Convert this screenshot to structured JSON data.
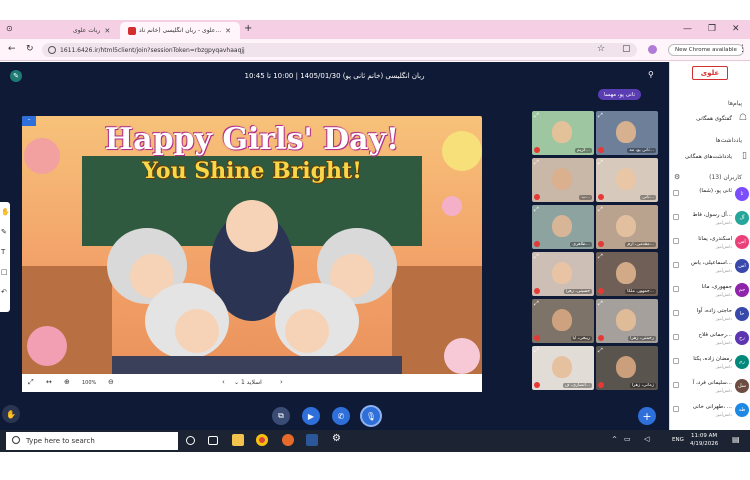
{
  "browser": {
    "tabs": [
      {
        "label": "ربات علوی"
      },
      {
        "label": "علوی - ربان انگلیسی (خانم ناد..."
      }
    ],
    "new_tab": "+",
    "url": "1611.6426.ir/html5client/join?sessionToken=rbzgpyqavhaaqjj",
    "chrome_available": "New Chrome available"
  },
  "app": {
    "title": "ربان انگلیسی (خانم ثانی پو) 1405/01/30 | 10:00 تا 10:45",
    "presenter_badge": "نانی پو، مهسا",
    "slide": {
      "line1": "Happy Girls' Day!",
      "line2": "You Shine Bright!",
      "slide_label": "اسلاید 1",
      "zoom": "100%"
    },
    "participants": [
      {
        "name": "ثانی پو، مه..."
      },
      {
        "name": "کریم..."
      },
      {
        "name": "ثانی..."
      },
      {
        "name": "ب..."
      },
      {
        "name": "مقدمی، ارم..."
      },
      {
        "name": "طاهری..."
      },
      {
        "name": "جمهور، ملکا..."
      },
      {
        "name": "حسینی، زهرا"
      },
      {
        "name": "رحمتی، زهرا"
      },
      {
        "name": "ربیعی، آیا"
      },
      {
        "name": "زمانی، زهرا"
      },
      {
        "name": "انصاری، ف..."
      },
      {
        "name": "صالحی، ملیکا"
      },
      {
        "name": "عادی، کیمیا"
      },
      {
        "name": "حسینی، فاطمه"
      },
      {
        "name": "کریمی، یاسمن"
      }
    ]
  },
  "sidebar": {
    "logo": "علوی",
    "messages_header": "پیام‌ها",
    "chat_item": "گفتگوی همگانی",
    "notes_header": "یادداشت‌ها",
    "notes_item": "یادداشت‌های همگانی",
    "users_header": "کاربران (13)",
    "users": [
      {
        "name": "ثانی پو، (شما)",
        "sub": "",
        "initials": "ثا",
        "color": "#7c4dff"
      },
      {
        "name": "آل رسول، فاط...",
        "sub": "دانش‌آموز",
        "initials": "آل",
        "color": "#26a69a"
      },
      {
        "name": "اسکندری، یمانا",
        "sub": "دانش‌آموز",
        "initials": "اس",
        "color": "#ec407a"
      },
      {
        "name": "اسماعیلی، یاس...",
        "sub": "دانش‌آموز",
        "initials": "اس",
        "color": "#3949ab"
      },
      {
        "name": "جمهوری، مانا",
        "sub": "دانش‌آموز",
        "initials": "جم",
        "color": "#8e24aa"
      },
      {
        "name": "حاجتی زاده، آوا",
        "sub": "دانش‌آموز",
        "initials": "حا",
        "color": "#3949ab"
      },
      {
        "name": "رحمانی فلاح...",
        "sub": "دانش‌آموز",
        "initials": "رح",
        "color": "#5e35b1"
      },
      {
        "name": "رمضان زاده، یکتا",
        "sub": "دانش‌آموز",
        "initials": "رم",
        "color": "#00897b"
      },
      {
        "name": "سلیمانی فرد، آ...",
        "sub": "دانش‌آموز",
        "initials": "سل",
        "color": "#6d4c41"
      },
      {
        "name": "طهرانی خانی، ...",
        "sub": "دانش‌آموز",
        "initials": "طه",
        "color": "#1e88e5"
      }
    ]
  },
  "taskbar": {
    "search_placeholder": "Type here to search",
    "lang": "ENG",
    "time": "11:09 AM",
    "date": "4/19/2026"
  }
}
